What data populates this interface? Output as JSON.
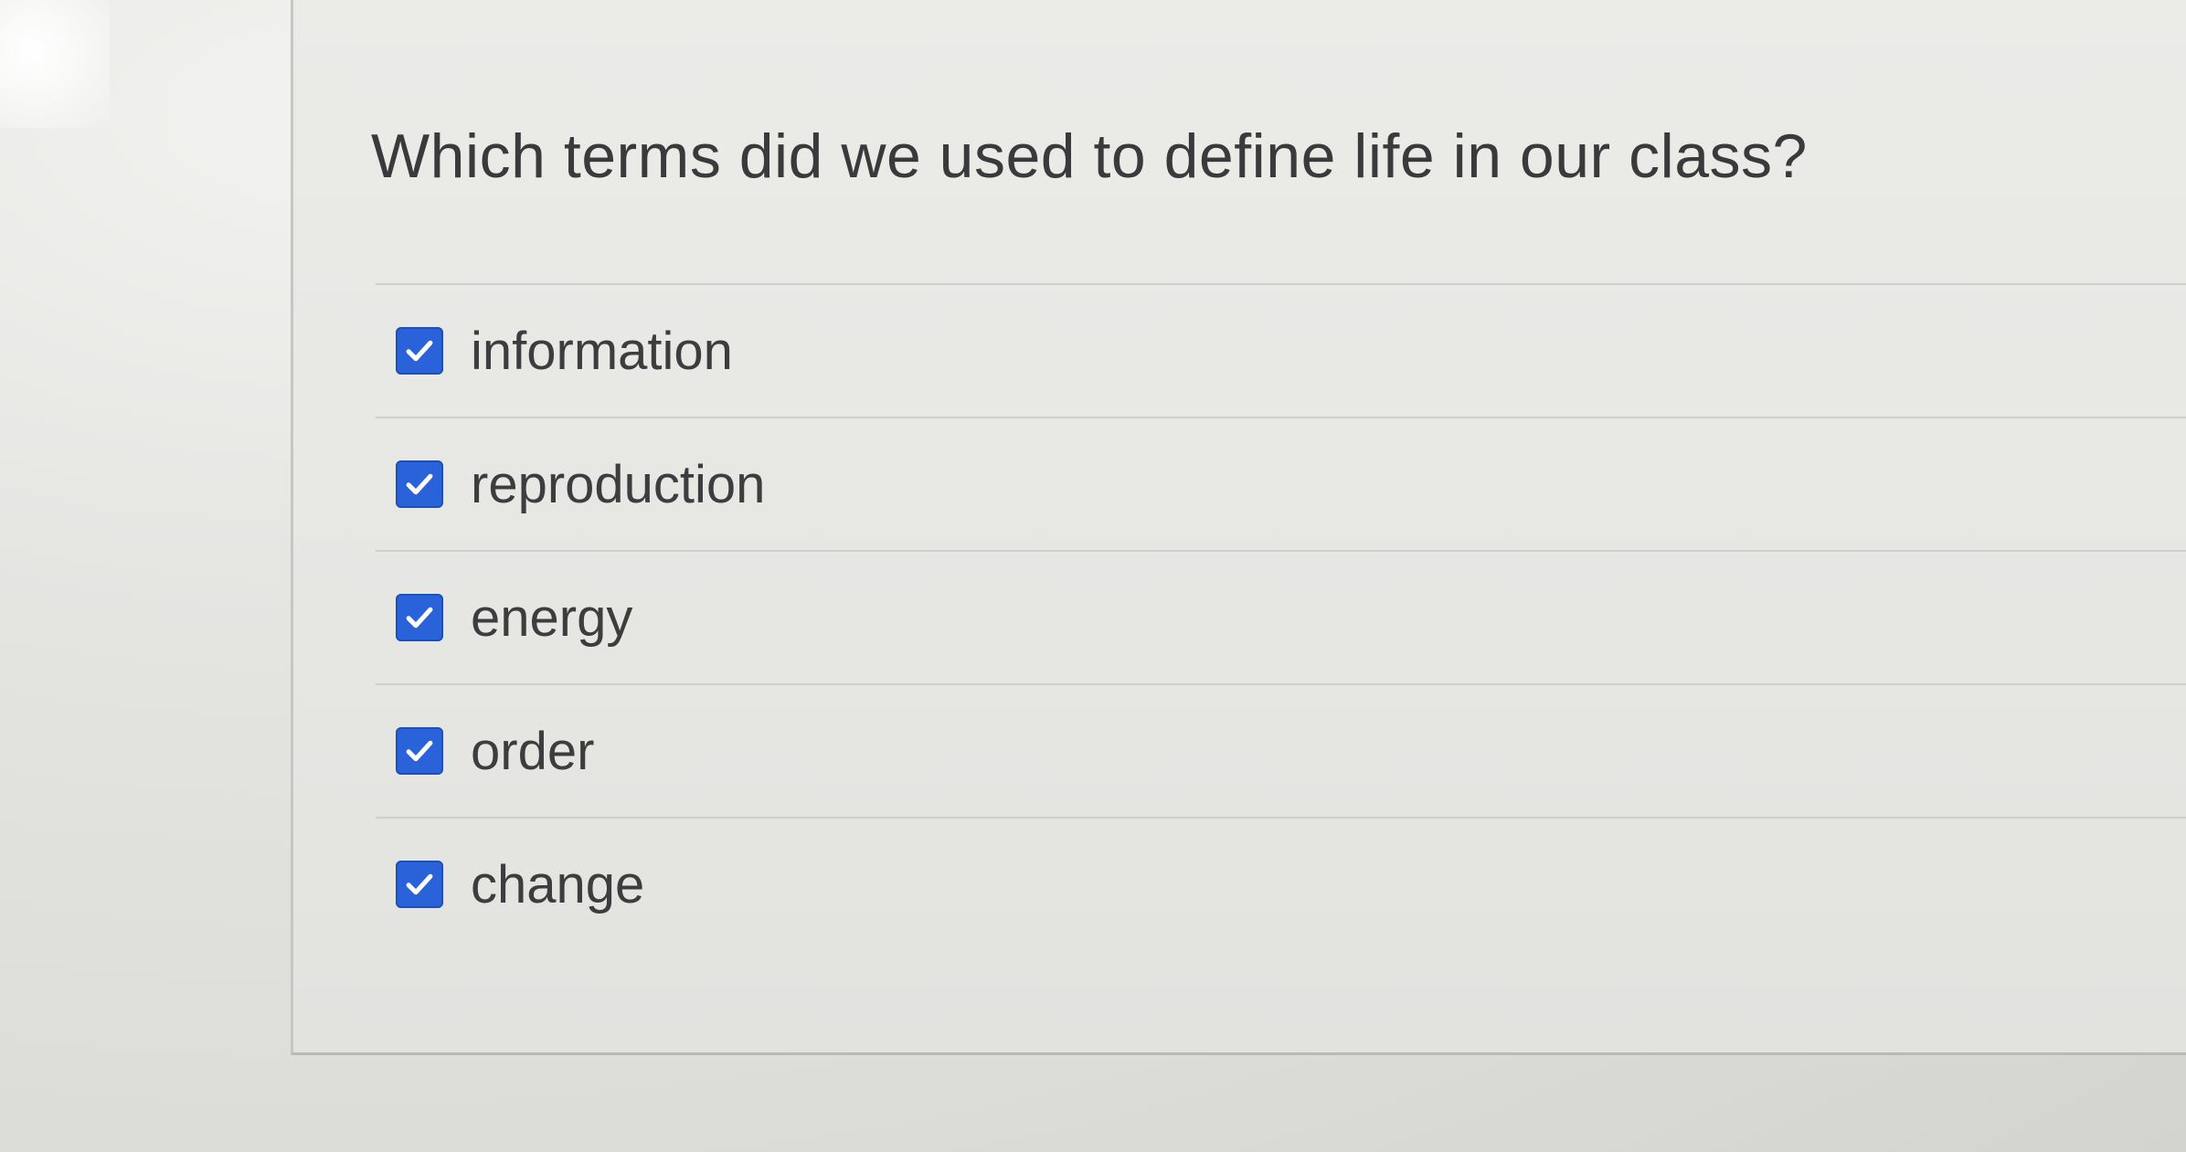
{
  "quiz": {
    "question": "Which terms did we used to define life in our class?",
    "answers": [
      {
        "label": "information",
        "checked": true
      },
      {
        "label": "reproduction",
        "checked": true
      },
      {
        "label": "energy",
        "checked": true
      },
      {
        "label": "order",
        "checked": true
      },
      {
        "label": "change",
        "checked": true
      }
    ]
  },
  "colors": {
    "checkbox_fill": "#2a62d9",
    "checkmark": "#ffffff",
    "text": "#3a3a3c"
  },
  "icons": {
    "checkbox": "checkbox-checked-icon"
  }
}
